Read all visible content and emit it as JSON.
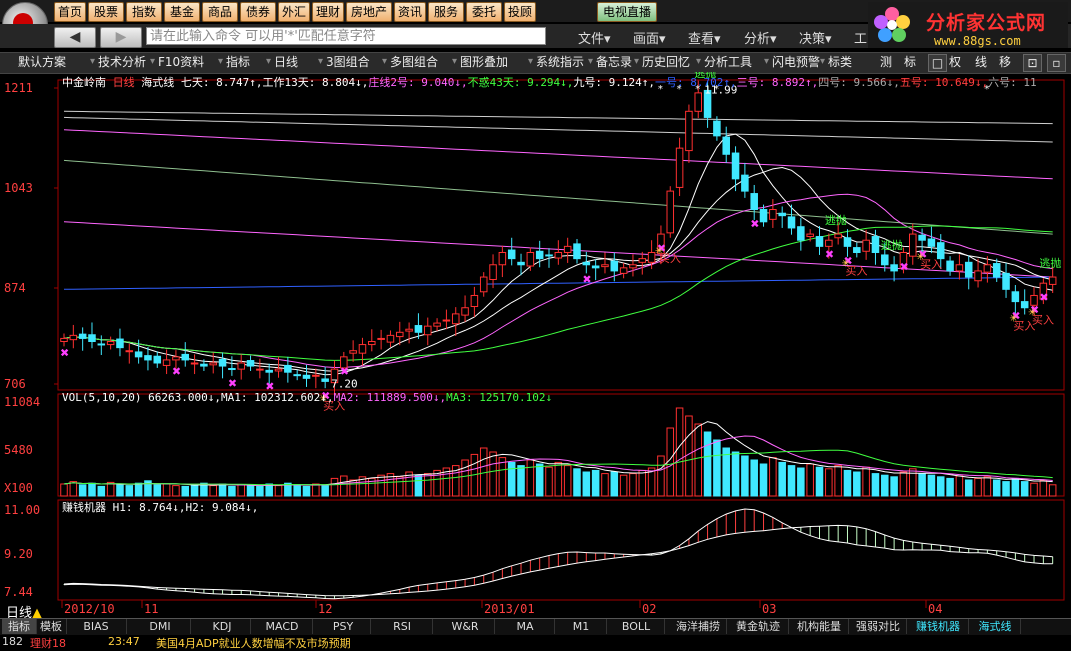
{
  "menu": [
    "首页",
    "股票",
    "指数",
    "基金",
    "商品",
    "债券",
    "外汇",
    "理财",
    "房地产",
    "资讯",
    "服务",
    "委托",
    "投顾"
  ],
  "menu_live": "电视直播",
  "command": {
    "placeholder": "请在此输入命令   可以用'*'匹配任意字符"
  },
  "nav_menus": [
    "文件▾",
    "画面▾",
    "查看▾",
    "分析▾",
    "决策▾",
    "工"
  ],
  "brand": {
    "title": "分析家公式网",
    "url": "www.88gs.com"
  },
  "toolbar": [
    "默认方案",
    "技术分析",
    "F10资料",
    "指标",
    "日线",
    "3图组合",
    "多图组合",
    "图形叠加",
    "系统指示",
    "备忘录",
    "历史回忆",
    "分析工具",
    "闪电预警",
    "标类"
  ],
  "toolbar_right": [
    "测",
    "标",
    "权",
    "线",
    "移"
  ],
  "main": {
    "stock": "中金岭南",
    "period": "日线",
    "formula": "海式线",
    "items": [
      {
        "label": "七天: 8.747↑,",
        "color": "#ffffff"
      },
      {
        "label": "工作13天: 8.804↓,",
        "color": "#ffffff"
      },
      {
        "label": "庄线2号: 9.040↓,",
        "color": "#ff66ff"
      },
      {
        "label": "不惑43天: 9.294↓,",
        "color": "#40ff40"
      },
      {
        "label": "九号: 9.124↑,",
        "color": "#ffffff"
      },
      {
        "label": "一号: 8.702↑,",
        "color": "#3060ff"
      },
      {
        "label": "三号: 8.892↑,",
        "color": "#ff66ff"
      },
      {
        "label": "四号: 9.566↓,",
        "color": "#aaaaaa"
      },
      {
        "label": "五号: 10.649↓,",
        "color": "#ff4040"
      },
      {
        "label": "六号: 11",
        "color": "#aaaaaa"
      }
    ],
    "y_labels": [
      "1211",
      "1043",
      "874",
      "706"
    ],
    "peak_label": "11.99",
    "low_label": "7.20",
    "sell_label": "逃抛",
    "buy_label": "买入"
  },
  "volume": {
    "label": "VOL(5,10,20)",
    "items": [
      {
        "label": "66263.000↓,",
        "color": "#ffffff"
      },
      {
        "label": "MA1: 102312.602↓,",
        "color": "#ffffff"
      },
      {
        "label": "MA2: 111889.500↓,",
        "color": "#ff66ff"
      },
      {
        "label": "MA3: 125170.102↓",
        "color": "#40ff40"
      }
    ],
    "y_labels": [
      "11084",
      "5480",
      "X100"
    ]
  },
  "indicator": {
    "label": "赚钱机器",
    "items": [
      {
        "label": "H1: 8.764↓,",
        "color": "#ffffff"
      },
      {
        "label": "H2: 9.084↓,",
        "color": "#ffffff"
      }
    ],
    "y_labels": [
      "11.00",
      "9.20",
      "7.44"
    ]
  },
  "dates": [
    "2012/10",
    "11",
    "12",
    "2013/01",
    "02",
    "03",
    "04"
  ],
  "period_label": "日线",
  "tabs": [
    "指标",
    "模板",
    "BIAS",
    "DMI",
    "KDJ",
    "MACD",
    "PSY",
    "RSI",
    "W&R",
    "MA",
    "M1",
    "BOLL",
    "海洋捕捞",
    "黄金轨迹",
    "机构能量",
    "强弱对比",
    "赚钱机器",
    "海式线"
  ],
  "status": {
    "code": "182",
    "time": "23:47",
    "news": "美国4月ADP就业人数增幅不及市场预期",
    "label": "理财18"
  },
  "colors": {
    "up": "#ff3030",
    "down": "#40e8ff",
    "ma_white": "#ffffff",
    "ma_purple": "#ff66ff",
    "ma_green": "#40ff40",
    "ma_blue": "#3060ff",
    "ma_gray": "#aaaaaa"
  },
  "chart_data": {
    "type": "candlestick",
    "price_axis": {
      "labels": [
        1211,
        1043,
        874,
        706
      ],
      "unit_divisor": 100
    },
    "price_range": [
      7.06,
      12.11
    ],
    "low": 7.2,
    "high": 11.99,
    "closes": [
      7.9,
      7.95,
      7.9,
      7.85,
      7.8,
      7.85,
      7.75,
      7.7,
      7.6,
      7.55,
      7.5,
      7.55,
      7.6,
      7.55,
      7.5,
      7.45,
      7.5,
      7.45,
      7.4,
      7.5,
      7.45,
      7.4,
      7.35,
      7.4,
      7.35,
      7.3,
      7.25,
      7.3,
      7.2,
      7.4,
      7.6,
      7.7,
      7.8,
      7.85,
      7.9,
      7.95,
      8.0,
      8.05,
      8.0,
      8.1,
      8.15,
      8.2,
      8.3,
      8.4,
      8.6,
      8.9,
      9.1,
      9.3,
      9.2,
      9.1,
      9.3,
      9.2,
      9.25,
      9.3,
      9.4,
      9.2,
      9.1,
      9.05,
      9.1,
      9.0,
      9.05,
      9.1,
      9.2,
      9.3,
      9.6,
      10.3,
      11.0,
      11.6,
      11.9,
      11.5,
      11.2,
      10.9,
      10.5,
      10.3,
      10.0,
      9.8,
      10.0,
      9.9,
      9.7,
      9.5,
      9.6,
      9.4,
      9.5,
      9.6,
      9.4,
      9.3,
      9.5,
      9.3,
      9.1,
      9.0,
      9.3,
      9.6,
      9.5,
      9.4,
      9.2,
      9.0,
      9.1,
      8.9,
      9.0,
      9.1,
      8.9,
      8.7,
      8.5,
      8.4,
      8.6,
      8.8,
      8.9
    ],
    "volumes": [
      15,
      18,
      14,
      16,
      12,
      17,
      15,
      13,
      16,
      19,
      14,
      15,
      13,
      12,
      14,
      16,
      13,
      15,
      12,
      14,
      13,
      12,
      15,
      13,
      16,
      14,
      12,
      15,
      13,
      22,
      25,
      20,
      24,
      22,
      26,
      28,
      24,
      30,
      26,
      28,
      32,
      35,
      38,
      45,
      52,
      60,
      55,
      48,
      42,
      38,
      45,
      40,
      36,
      42,
      38,
      34,
      30,
      32,
      28,
      30,
      26,
      28,
      32,
      35,
      50,
      85,
      110,
      100,
      90,
      80,
      70,
      60,
      55,
      50,
      45,
      40,
      48,
      42,
      38,
      35,
      40,
      36,
      34,
      38,
      32,
      30,
      36,
      28,
      26,
      24,
      30,
      34,
      28,
      26,
      24,
      22,
      25,
      20,
      22,
      24,
      20,
      18,
      22,
      18,
      16,
      20,
      14
    ]
  }
}
